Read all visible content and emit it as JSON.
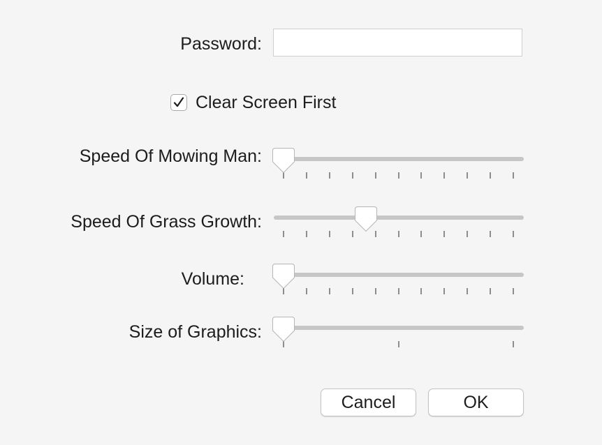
{
  "password": {
    "label": "Password:",
    "value": "",
    "placeholder": ""
  },
  "clear_screen": {
    "label": "Clear Screen First",
    "checked": true,
    "check_glyph": "✓"
  },
  "sliders": [
    {
      "id": "mowing",
      "label": "Speed Of Mowing Man:",
      "value_fraction": 0.0,
      "tick_count": 11
    },
    {
      "id": "grass",
      "label": "Speed Of Grass Growth:",
      "value_fraction": 0.36,
      "tick_count": 11
    },
    {
      "id": "volume",
      "label": "Volume:",
      "value_fraction": 0.0,
      "tick_count": 11
    },
    {
      "id": "graphics",
      "label": "Size of Graphics:",
      "value_fraction": 0.0,
      "tick_count": 3
    }
  ],
  "buttons": {
    "cancel": "Cancel",
    "ok": "OK"
  },
  "colors": {
    "background": "#f5f5f5",
    "track": "#c6c6c6",
    "tick": "#8d8d8d",
    "thumb_border": "#b5b5b5"
  }
}
